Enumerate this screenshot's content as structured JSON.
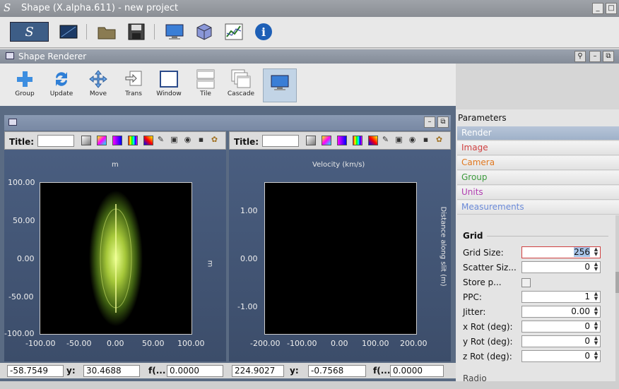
{
  "app": {
    "title": "Shape (X.alpha.611) - new project",
    "logo": "S"
  },
  "main_toolbar": {
    "icons": [
      "shape-logo-icon",
      "render-icon",
      "folder-open-icon",
      "save-icon",
      "monitor-icon",
      "cube-icon",
      "graph-icon",
      "info-icon"
    ]
  },
  "renderer": {
    "title": "Shape Renderer",
    "tools": [
      {
        "label": "Group",
        "icon": "plus-icon"
      },
      {
        "label": "Update",
        "icon": "refresh-icon"
      },
      {
        "label": "Move",
        "icon": "move-icon"
      },
      {
        "label": "Trans",
        "icon": "transform-icon"
      },
      {
        "label": "Window",
        "icon": "window-icon"
      },
      {
        "label": "Tile",
        "icon": "tile-icon"
      },
      {
        "label": "Cascade",
        "icon": "cascade-icon"
      },
      {
        "label": "",
        "icon": "monitor-icon"
      }
    ]
  },
  "plot1": {
    "title_label": "Title:",
    "title_value": "",
    "top_label": "m",
    "right_label": "m",
    "yticks": [
      "100.00",
      "50.00",
      "0.00",
      "-50.00",
      "-100.00"
    ],
    "xticks": [
      "-100.00",
      "-50.00",
      "0.00",
      "50.00",
      "100.00"
    ]
  },
  "plot2": {
    "title_label": "Title:",
    "title_value": "",
    "top_label": "Velocity (km/s)",
    "right_label": "Distance along slit (m)",
    "yticks": [
      "1.00",
      "0.00",
      "-1.00"
    ],
    "xticks": [
      "-200.00",
      "-100.00",
      "0.00",
      "100.00",
      "200.00"
    ]
  },
  "status": {
    "x1": "-58.7549",
    "y_label": "y:",
    "y1": "30.4688",
    "f_label": "f(...",
    "f1": "0.0000",
    "x2": "224.9027",
    "y2": "-0.7568",
    "f2": "0.0000"
  },
  "params": {
    "title": "Parameters",
    "sections": [
      {
        "label": "Render",
        "color": "#ffffff"
      },
      {
        "label": "Image",
        "color": "#d04040"
      },
      {
        "label": "Camera",
        "color": "#e07820"
      },
      {
        "label": "Group",
        "color": "#3c9a3c"
      },
      {
        "label": "Units",
        "color": "#b03cb0"
      },
      {
        "label": "Measurements",
        "color": "#6a8ad8"
      }
    ],
    "grid_header": "Grid",
    "rows": [
      {
        "label": "Grid Size:",
        "value": "256"
      },
      {
        "label": "Scatter Siz...",
        "value": "0"
      },
      {
        "label": "Store p...",
        "value": ""
      },
      {
        "label": "PPC:",
        "value": "1"
      },
      {
        "label": "Jitter:",
        "value": "0.00"
      },
      {
        "label": "x Rot (deg):",
        "value": "0"
      },
      {
        "label": "y Rot (deg):",
        "value": "0"
      },
      {
        "label": "z Rot (deg):",
        "value": "0"
      }
    ],
    "next_label": "Radio"
  }
}
